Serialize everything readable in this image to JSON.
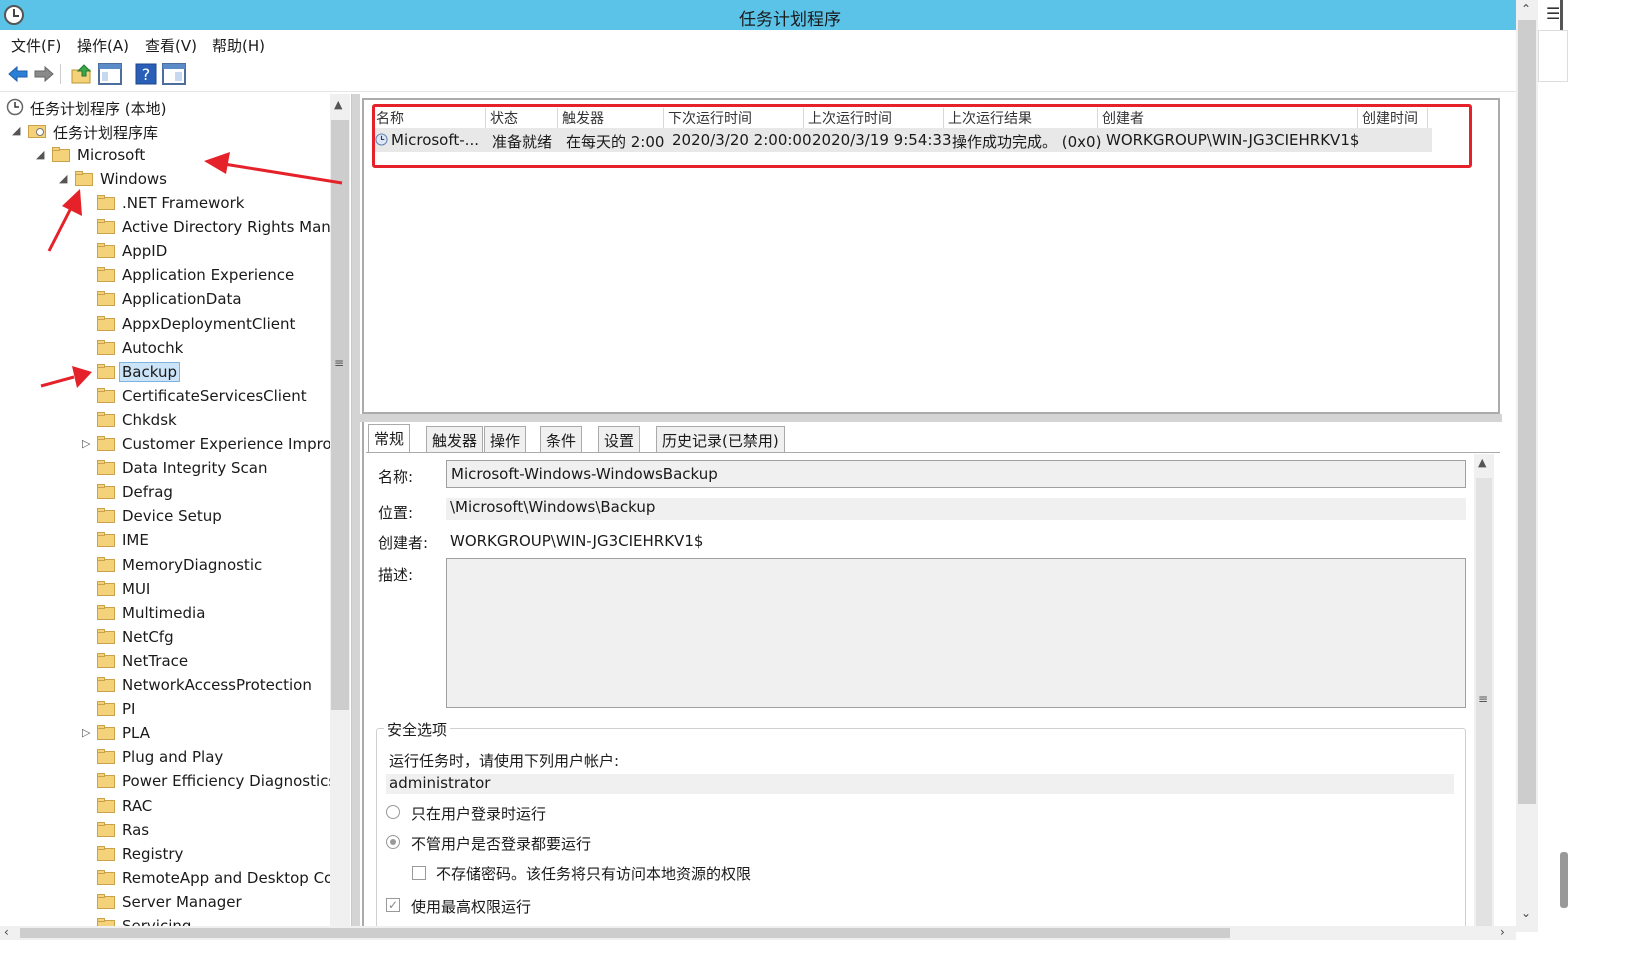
{
  "window": {
    "title": "任务计划程序"
  },
  "menu": [
    {
      "label": "文件(F)"
    },
    {
      "label": "操作(A)"
    },
    {
      "label": "查看(V)"
    },
    {
      "label": "帮助(H)"
    }
  ],
  "toolbar": {
    "icons": [
      "back-arrow-icon",
      "forward-arrow-icon",
      "up-folder-icon",
      "show-hide-console-tree-icon",
      "help-icon",
      "action-pane-icon"
    ]
  },
  "tree": {
    "root": "任务计划程序 (本地)",
    "library": "任务计划程序库",
    "microsoft": "Microsoft",
    "windows": "Windows",
    "children": [
      {
        "label": ".NET Framework",
        "expandable": false
      },
      {
        "label": "Active Directory Rights Manag",
        "expandable": false
      },
      {
        "label": "AppID",
        "expandable": false
      },
      {
        "label": "Application Experience",
        "expandable": false
      },
      {
        "label": "ApplicationData",
        "expandable": false
      },
      {
        "label": "AppxDeploymentClient",
        "expandable": false
      },
      {
        "label": "Autochk",
        "expandable": false
      },
      {
        "label": "Backup",
        "expandable": false,
        "selected": true
      },
      {
        "label": "CertificateServicesClient",
        "expandable": false
      },
      {
        "label": "Chkdsk",
        "expandable": false
      },
      {
        "label": "Customer Experience Improve",
        "expandable": true
      },
      {
        "label": "Data Integrity Scan",
        "expandable": false
      },
      {
        "label": "Defrag",
        "expandable": false
      },
      {
        "label": "Device Setup",
        "expandable": false
      },
      {
        "label": "IME",
        "expandable": false
      },
      {
        "label": "MemoryDiagnostic",
        "expandable": false
      },
      {
        "label": "MUI",
        "expandable": false
      },
      {
        "label": "Multimedia",
        "expandable": false
      },
      {
        "label": "NetCfg",
        "expandable": false
      },
      {
        "label": "NetTrace",
        "expandable": false
      },
      {
        "label": "NetworkAccessProtection",
        "expandable": false
      },
      {
        "label": "PI",
        "expandable": false
      },
      {
        "label": "PLA",
        "expandable": true
      },
      {
        "label": "Plug and Play",
        "expandable": false
      },
      {
        "label": "Power Efficiency Diagnostics",
        "expandable": false
      },
      {
        "label": "RAC",
        "expandable": false
      },
      {
        "label": "Ras",
        "expandable": false
      },
      {
        "label": "Registry",
        "expandable": false
      },
      {
        "label": "RemoteApp and Desktop Cor",
        "expandable": false
      },
      {
        "label": "Server Manager",
        "expandable": false
      },
      {
        "label": "Servicing",
        "expandable": false
      }
    ]
  },
  "tasklist": {
    "columns": [
      "名称",
      "状态",
      "触发器",
      "下次运行时间",
      "上次运行时间",
      "上次运行结果",
      "创建者",
      "创建时间"
    ],
    "rows": [
      {
        "name": "Microsoft-...",
        "status": "准备就绪",
        "trigger": "在每天的 2:00",
        "next_run": "2020/3/20 2:00:00",
        "last_run": "2020/3/19 9:54:33",
        "last_result": "操作成功完成。 (0x0)",
        "author": "WORKGROUP\\WIN-JG3CIEHRKV1$",
        "created": ""
      }
    ]
  },
  "tabs": [
    "常规",
    "触发器",
    "操作",
    "条件",
    "设置",
    "历史记录(已禁用)"
  ],
  "general": {
    "name_label": "名称:",
    "name_value": "Microsoft-Windows-WindowsBackup",
    "location_label": "位置:",
    "location_value": "\\Microsoft\\Windows\\Backup",
    "author_label": "创建者:",
    "author_value": "WORKGROUP\\WIN-JG3CIEHRKV1$",
    "description_label": "描述:",
    "description_value": ""
  },
  "security": {
    "title": "安全选项",
    "run_as_prompt": "运行任务时，请使用下列用户帐户:",
    "user_account": "administrator",
    "option_logged_on": "只在用户登录时运行",
    "option_whether_logged_on": "不管用户是否登录都要运行",
    "selected_option": "option_whether_logged_on",
    "no_store_password": "不存储密码。该任务将只有访问本地资源的权限",
    "highest_privileges": "使用最高权限运行",
    "highest_privileges_checked": true
  },
  "colors": {
    "titlebar": "#5bc3e8",
    "annotation": "#e5222a",
    "selection": "#cce4f7",
    "folder": "#f3d27a"
  }
}
